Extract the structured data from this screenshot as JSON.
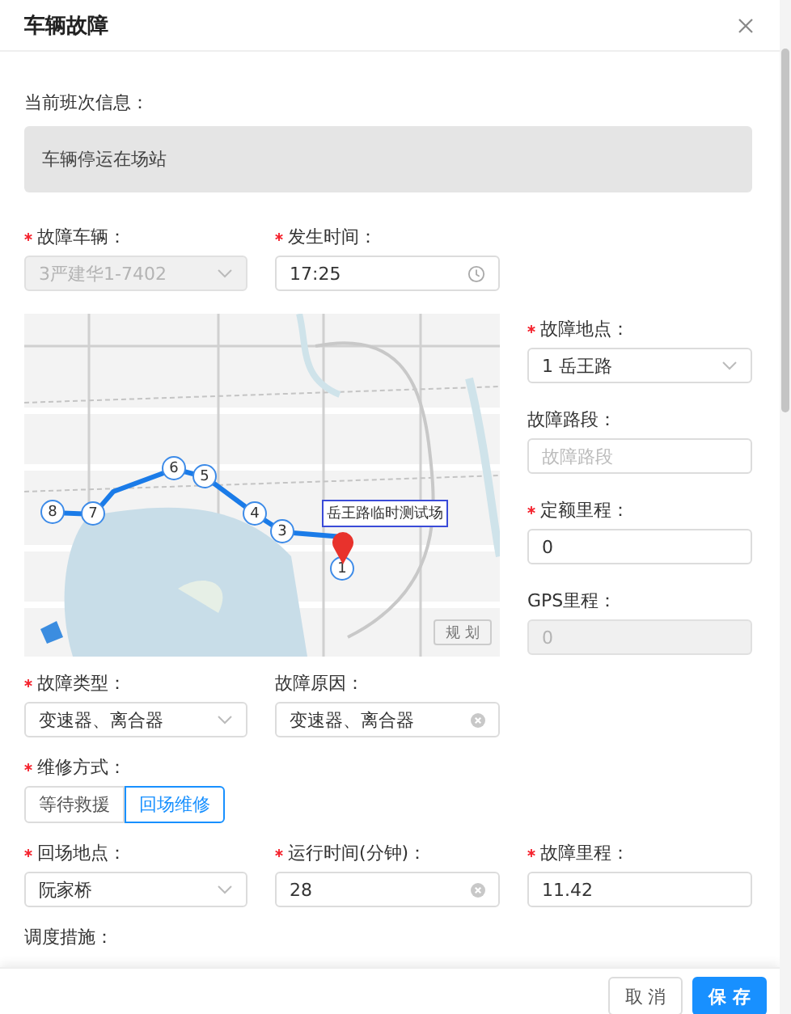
{
  "dialog": {
    "title": "车辆故障"
  },
  "shift_info": {
    "label": "当前班次信息：",
    "value": "车辆停运在场站"
  },
  "vehicle_row": [
    {
      "label": "故障车辆：",
      "required": true,
      "kind": "select",
      "value": "3严建华1-7402",
      "disabled": true
    },
    {
      "label": "发生时间：",
      "required": true,
      "kind": "time",
      "value": "17:25",
      "disabled": false
    }
  ],
  "map": {
    "kind": "picture",
    "stops": [
      "8",
      "7",
      "6",
      "5",
      "4",
      "3",
      "1"
    ],
    "tooltip": "岳王路临时测试场",
    "plan_button": "规 划"
  },
  "map_side_fields": [
    {
      "label": "故障地点：",
      "required": true,
      "kind": "select",
      "value": "1 岳王路",
      "disabled": false
    },
    {
      "label": "故障路段：",
      "required": false,
      "kind": "input",
      "placeholder": "故障路段",
      "disabled": false
    },
    {
      "label": "定额里程：",
      "required": true,
      "kind": "input",
      "value": "0",
      "disabled": false
    },
    {
      "label": "GPS里程：",
      "required": false,
      "kind": "input",
      "value": "0",
      "disabled": true
    }
  ],
  "type_row": [
    {
      "label": "故障类型：",
      "required": true,
      "kind": "select",
      "value": "变速器、离合器",
      "disabled": false
    },
    {
      "label": "故障原因：",
      "required": false,
      "kind": "clearable",
      "value": "变速器、离合器",
      "disabled": false
    }
  ],
  "repair_method": {
    "label": "维修方式：",
    "required": true,
    "options": [
      {
        "label": "等待救援",
        "selected": false
      },
      {
        "label": "回场维修",
        "selected": true
      }
    ]
  },
  "return_row": [
    {
      "label": "回场地点：",
      "required": true,
      "kind": "select",
      "value": "阮家桥",
      "disabled": false
    },
    {
      "label": "运行时间(分钟)：",
      "required": true,
      "kind": "clearable",
      "value": "28",
      "disabled": false
    },
    {
      "label": "故障里程：",
      "required": true,
      "kind": "input",
      "value": "11.42",
      "disabled": false
    }
  ],
  "dispatch": {
    "label": "调度措施："
  },
  "footer": {
    "buttons": [
      {
        "label": "取 消",
        "kind": "secondary"
      },
      {
        "label": "保 存",
        "kind": "primary"
      }
    ]
  }
}
